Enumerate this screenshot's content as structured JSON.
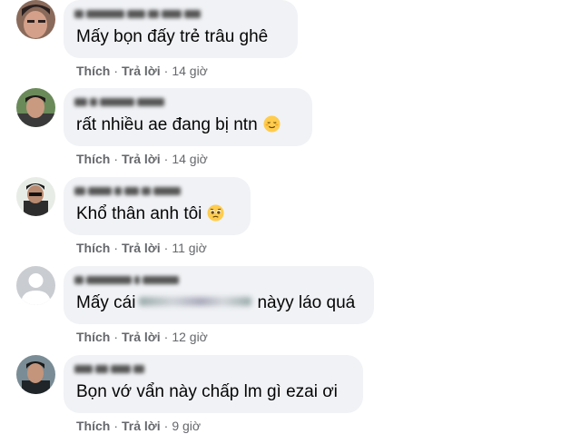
{
  "comments": [
    {
      "text": "Mấy bọn đấy trẻ trâu ghê",
      "like_label": "Thích",
      "reply_label": "Trả lời",
      "time": "14 giờ",
      "emoji": ""
    },
    {
      "text": "rất nhiều ae đang bị ntn",
      "like_label": "Thích",
      "reply_label": "Trả lời",
      "time": "14 giờ",
      "emoji": "relieved-face-emoji"
    },
    {
      "text": "Khổ thân anh tôi",
      "like_label": "Thích",
      "reply_label": "Trả lời",
      "time": "11 giờ",
      "emoji": "pleading-face-emoji"
    },
    {
      "text_before": "Mấy cái",
      "text_after": "nàyy láo quá",
      "like_label": "Thích",
      "reply_label": "Trả lời",
      "time": "12 giờ",
      "emoji": ""
    },
    {
      "text": "Bọn vớ vẩn này chấp lm gì ezai ơi",
      "like_label": "Thích",
      "reply_label": "Trả lời",
      "time": "9 giờ",
      "emoji": ""
    }
  ],
  "separator": "·",
  "colors": {
    "bubble": "#f0f2f5",
    "text": "#050505",
    "meta": "#65676b",
    "emoji": "#ffcc4d"
  }
}
